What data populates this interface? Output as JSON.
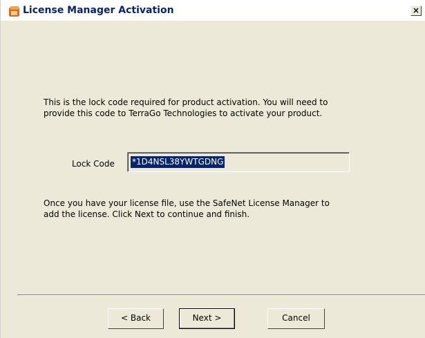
{
  "window": {
    "title": "License Manager Activation",
    "close_label": "×"
  },
  "content": {
    "intro_text": "This is the lock code required for product activation. You will need to provide this code to TerraGo Technologies to activate your product.",
    "lock_code_label": "Lock Code",
    "lock_code_value": "*1D4NSL38YWTGDNG",
    "followup_text": "Once you have your license file, use the SafeNet License Manager to add the license. Click Next to continue and finish."
  },
  "buttons": {
    "back": "< Back",
    "next": "Next >",
    "cancel": "Cancel"
  }
}
